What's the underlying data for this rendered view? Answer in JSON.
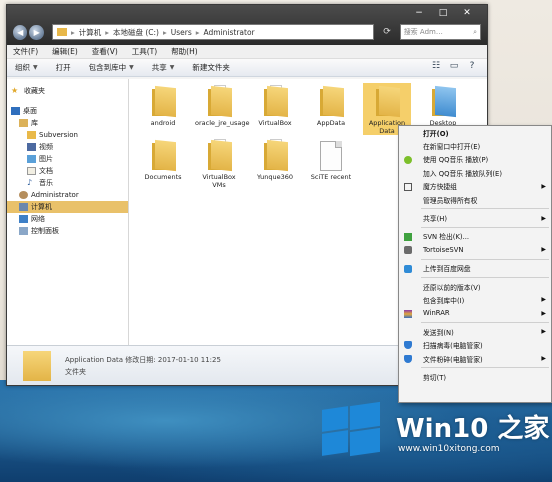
{
  "titlebar": {
    "breadcrumb": [
      "计算机",
      "本地磁盘 (C:)",
      "Users",
      "Administrator"
    ],
    "search_placeholder": "搜索 Adm…",
    "controls": [
      "−",
      "□",
      "✕"
    ]
  },
  "menubar": [
    "文件(F)",
    "编辑(E)",
    "查看(V)",
    "工具(T)",
    "帮助(H)"
  ],
  "toolbar": {
    "organize": "组织",
    "open": "打开",
    "include_library": "包含到库中",
    "share": "共享",
    "new_folder": "新建文件夹"
  },
  "sidebar": [
    {
      "label": "收藏夹",
      "icon": "star-icon"
    },
    {
      "label": "桌面",
      "icon": "desktop-icon"
    },
    {
      "label": "库",
      "icon": "library-icon"
    },
    {
      "label": "Subversion",
      "icon": "folder-icon"
    },
    {
      "label": "视频",
      "icon": "video-icon"
    },
    {
      "label": "图片",
      "icon": "picture-icon"
    },
    {
      "label": "文档",
      "icon": "document-icon"
    },
    {
      "label": "音乐",
      "icon": "music-icon"
    },
    {
      "label": "Administrator",
      "icon": "user-icon"
    },
    {
      "label": "计算机",
      "icon": "computer-icon",
      "selected": true
    },
    {
      "label": "网络",
      "icon": "network-icon"
    },
    {
      "label": "控制面板",
      "icon": "control-panel-icon"
    }
  ],
  "files": [
    {
      "name": "android"
    },
    {
      "name": "oracle_jre_usage"
    },
    {
      "name": "VirtualBox"
    },
    {
      "name": "AppData"
    },
    {
      "name": "Application Data",
      "selected": true
    },
    {
      "name": "Desktop"
    },
    {
      "name": "Documents"
    },
    {
      "name": "VirtualBox VMs"
    },
    {
      "name": "Yunque360"
    },
    {
      "name": "SciTE recent"
    }
  ],
  "details": {
    "line1": "Application Data 修改日期: 2017-01-10 11:25",
    "line2": "文件夹"
  },
  "context_menu": [
    {
      "label": "打开(O)",
      "bold": true
    },
    {
      "label": "在新窗口中打开(E)"
    },
    {
      "label": "使用 QQ音乐 播放(P)",
      "icon": "qq-music-icon"
    },
    {
      "label": "加入 QQ音乐 播放队列(E)"
    },
    {
      "label": "魔方快捷组",
      "icon": "grid-icon",
      "submenu": true
    },
    {
      "label": "管理员取得所有权"
    },
    {
      "divider": true
    },
    {
      "label": "共享(H)",
      "submenu": true
    },
    {
      "divider": true
    },
    {
      "label": "SVN 检出(K)...",
      "icon": "svn-checkout-icon"
    },
    {
      "label": "TortoiseSVN",
      "icon": "tortoisesvn-icon",
      "submenu": true
    },
    {
      "divider": true
    },
    {
      "label": "上传到百度网盘",
      "icon": "baidu-cloud-icon"
    },
    {
      "divider": true
    },
    {
      "label": "还原以前的版本(V)"
    },
    {
      "label": "包含到库中(I)",
      "submenu": true
    },
    {
      "label": "WinRAR",
      "icon": "winrar-icon",
      "submenu": true
    },
    {
      "divider": true
    },
    {
      "label": "发送到(N)",
      "submenu": true
    },
    {
      "label": "扫描病毒(电脑管家)",
      "icon": "shield-icon"
    },
    {
      "label": "文件粉碎(电脑管家)",
      "icon": "shield-icon",
      "submenu": true
    },
    {
      "divider": true
    },
    {
      "label": "剪切(T)"
    }
  ],
  "watermark": {
    "brand": "Win10 之家",
    "url": "www.win10xitong.com"
  },
  "colors": {
    "selection": "#f5cf6a",
    "titlebar": "#2b2b2b",
    "brand_blue": "#1e88d8"
  }
}
